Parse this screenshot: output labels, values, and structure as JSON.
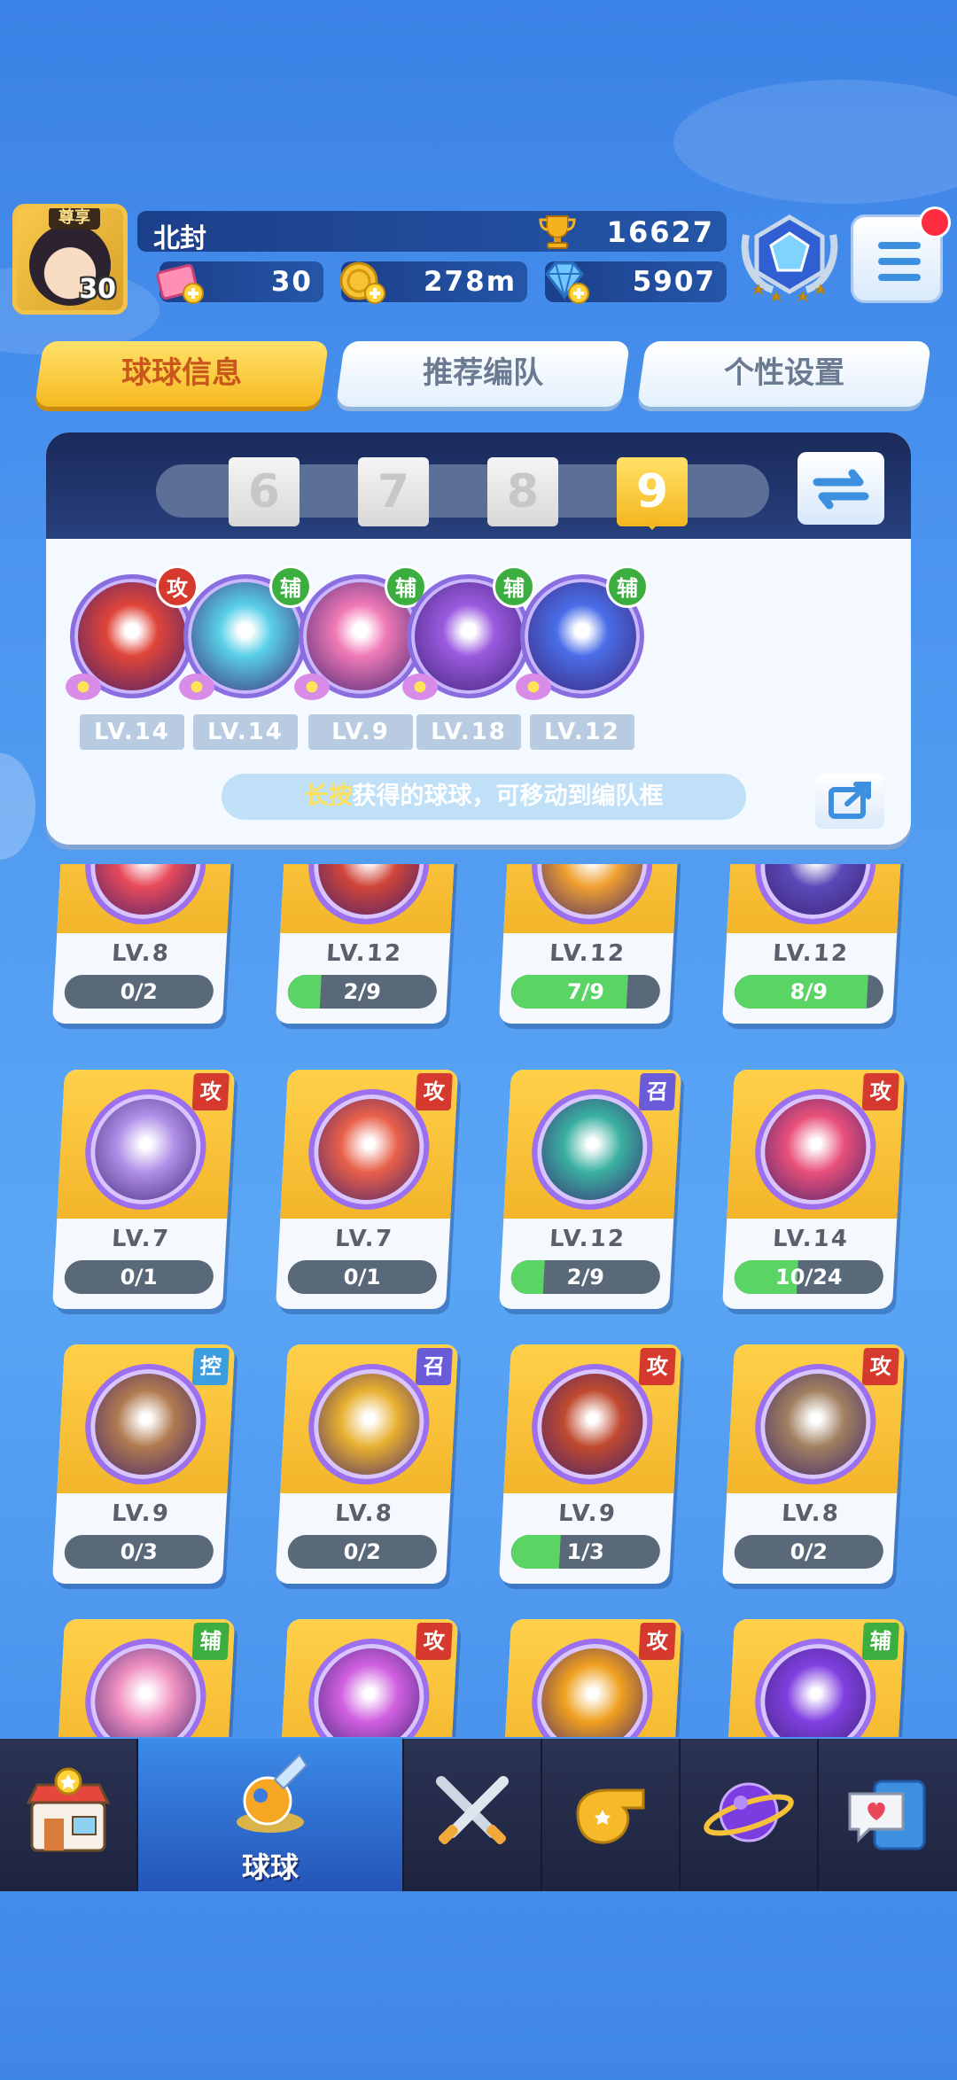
{
  "player": {
    "name": "北封",
    "vip_label": "尊享",
    "level": "30",
    "trophies": "16627",
    "tickets": "30",
    "coins": "278m",
    "gems": "5907"
  },
  "tabs": [
    {
      "label": "球球信息",
      "active": true
    },
    {
      "label": "推荐编队",
      "active": false
    },
    {
      "label": "个性设置",
      "active": false
    }
  ],
  "team_selector": {
    "numbers": [
      "6",
      "7",
      "8",
      "9"
    ],
    "selected": "9"
  },
  "team_balls": [
    {
      "role": "攻",
      "level": "LV.14",
      "color": "#e0453a"
    },
    {
      "role": "辅",
      "level": "LV.14",
      "color": "#5ad0e8"
    },
    {
      "role": "辅",
      "level": "LV.9",
      "color": "#f07ab6"
    },
    {
      "role": "辅",
      "level": "LV.18",
      "color": "#9b5be0"
    },
    {
      "role": "辅",
      "level": "LV.12",
      "color": "#4a6ee8"
    }
  ],
  "hint": {
    "highlight": "长按",
    "text": "获得的球球，可移动到编队框"
  },
  "collection": [
    {
      "role": "",
      "level": "LV.8",
      "progress": "0/2",
      "fill": 0,
      "color": "#e84a5a"
    },
    {
      "role": "",
      "level": "LV.12",
      "progress": "2/9",
      "fill": 0.22,
      "color": "#d0453a"
    },
    {
      "role": "",
      "level": "LV.12",
      "progress": "7/9",
      "fill": 0.78,
      "color": "#f0a030"
    },
    {
      "role": "",
      "level": "LV.12",
      "progress": "8/9",
      "fill": 0.89,
      "color": "#5a4ab8"
    },
    {
      "role": "攻",
      "level": "LV.7",
      "progress": "0/1",
      "fill": 0,
      "color": "#b090e8"
    },
    {
      "role": "攻",
      "level": "LV.7",
      "progress": "0/1",
      "fill": 0,
      "color": "#e8604a"
    },
    {
      "role": "召",
      "level": "LV.12",
      "progress": "2/9",
      "fill": 0.22,
      "color": "#3ab0a0"
    },
    {
      "role": "攻",
      "level": "LV.14",
      "progress": "10/24",
      "fill": 0.42,
      "color": "#e8507a"
    },
    {
      "role": "控",
      "level": "LV.9",
      "progress": "0/3",
      "fill": 0,
      "color": "#b07a50"
    },
    {
      "role": "召",
      "level": "LV.8",
      "progress": "0/2",
      "fill": 0,
      "color": "#e8b030"
    },
    {
      "role": "攻",
      "level": "LV.9",
      "progress": "1/3",
      "fill": 0.33,
      "color": "#c04a30"
    },
    {
      "role": "攻",
      "level": "LV.8",
      "progress": "0/2",
      "fill": 0,
      "color": "#a08060"
    },
    {
      "role": "辅",
      "level": "",
      "progress": "",
      "fill": 0,
      "color": "#f090c0"
    },
    {
      "role": "攻",
      "level": "",
      "progress": "",
      "fill": 0,
      "color": "#d060e0"
    },
    {
      "role": "攻",
      "level": "",
      "progress": "",
      "fill": 0,
      "color": "#f0a020"
    },
    {
      "role": "辅",
      "level": "",
      "progress": "",
      "fill": 0,
      "color": "#8040e0"
    }
  ],
  "bottom_nav": [
    {
      "icon": "shop-icon",
      "label": ""
    },
    {
      "icon": "balls-icon",
      "label": "球球",
      "active": true
    },
    {
      "icon": "battle-swords-icon",
      "label": ""
    },
    {
      "icon": "whistle-icon",
      "label": ""
    },
    {
      "icon": "planet-icon",
      "label": ""
    },
    {
      "icon": "chat-heart-icon",
      "label": ""
    }
  ]
}
